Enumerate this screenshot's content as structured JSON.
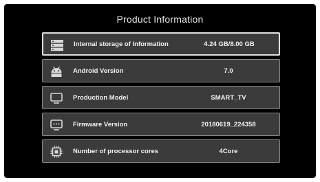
{
  "header": {
    "title": "Product Information"
  },
  "rows": [
    {
      "icon": "storage-icon",
      "label": "Internal storage of Information",
      "value": "4.24 GB/8.00 GB"
    },
    {
      "icon": "android-icon",
      "label": "Android Version",
      "value": "7.0"
    },
    {
      "icon": "monitor-icon",
      "label": "Production Model",
      "value": "SMART_TV"
    },
    {
      "icon": "firmware-icon",
      "label": "Firmware Version",
      "value": "20180619_224358"
    },
    {
      "icon": "processor-icon",
      "label": "Number of processor cores",
      "value": "4Core"
    }
  ],
  "colors": {
    "background": "#000000",
    "row_fill": "#3b3b3b",
    "row_border": "#8a8a8a",
    "selected_border": "#e0e0e0",
    "text": "#f2f2f2"
  }
}
